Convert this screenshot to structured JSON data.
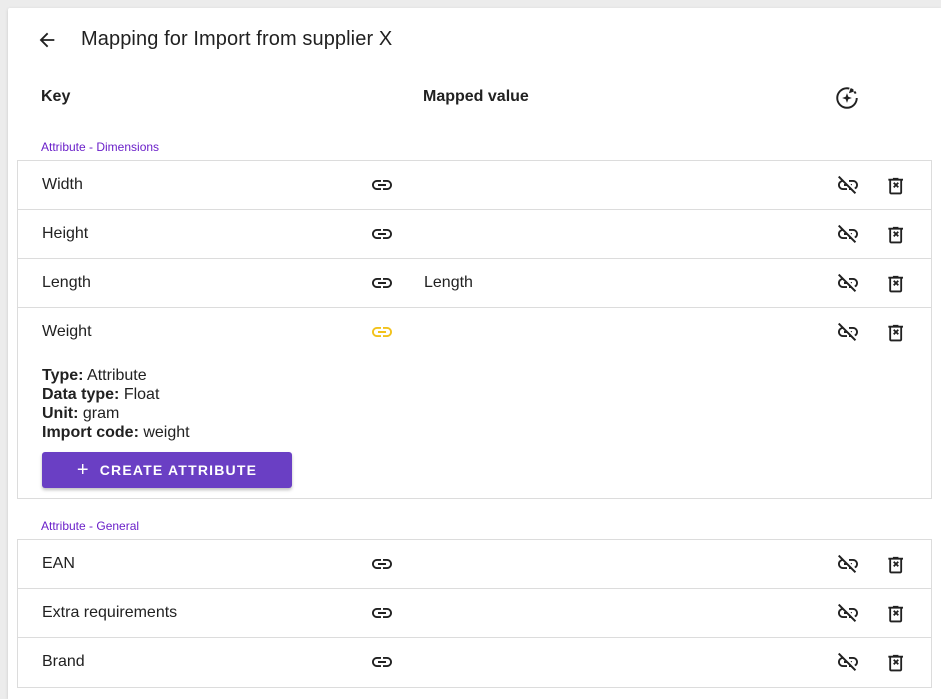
{
  "header": {
    "title": "Mapping for Import from supplier X"
  },
  "columns": {
    "key": "Key",
    "mapped": "Mapped value"
  },
  "groups": [
    {
      "label": "Attribute - Dimensions",
      "rows": [
        {
          "key": "Width",
          "mapped": "",
          "link_state": "linked"
        },
        {
          "key": "Height",
          "mapped": "",
          "link_state": "linked"
        },
        {
          "key": "Length",
          "mapped": "Length",
          "link_state": "linked"
        },
        {
          "key": "Weight",
          "mapped": "",
          "link_state": "unmatched",
          "details": {
            "type_label": "Type:",
            "type_value": "Attribute",
            "datatype_label": "Data type:",
            "datatype_value": "Float",
            "unit_label": "Unit:",
            "unit_value": "gram",
            "importcode_label": "Import code:",
            "importcode_value": "weight"
          },
          "create_label": "CREATE ATTRIBUTE"
        }
      ]
    },
    {
      "label": "Attribute - General",
      "rows": [
        {
          "key": "EAN",
          "mapped": "",
          "link_state": "linked"
        },
        {
          "key": "Extra requirements",
          "mapped": "",
          "link_state": "linked"
        },
        {
          "key": "Brand",
          "mapped": "",
          "link_state": "linked"
        }
      ]
    }
  ],
  "colors": {
    "accent": "#6a3fc4",
    "group_label": "#6a1fc9",
    "warning_link": "#f2c21b",
    "icon": "#212121"
  },
  "icons": {
    "back": "arrow-left-icon",
    "auto_map": "auto-map-icon",
    "link": "link-icon",
    "unlink": "link-off-icon",
    "delete": "delete-x-icon",
    "add": "plus-icon"
  }
}
